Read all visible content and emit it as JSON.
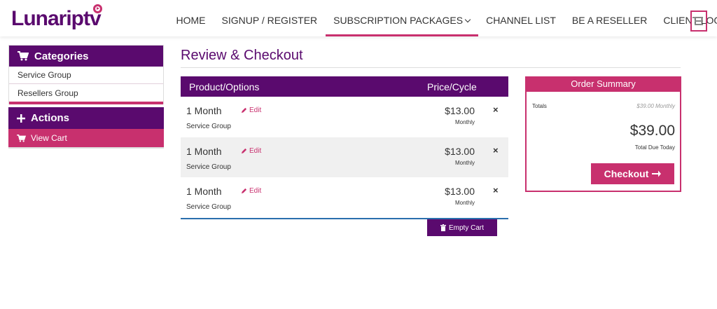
{
  "brand": {
    "logo_text": "Lunariptv"
  },
  "nav": {
    "items": [
      {
        "label": "HOME"
      },
      {
        "label": "SIGNUP / REGISTER"
      },
      {
        "label": "SUBSCRIPTION PACKAGES"
      },
      {
        "label": "CHANNEL LIST"
      },
      {
        "label": "BE A RESELLER"
      },
      {
        "label": "CLIENT LOGIN"
      }
    ],
    "menu_icon": "hamburger-icon"
  },
  "sidebar": {
    "categories_title": "Categories",
    "categories": [
      {
        "label": "Service Group"
      },
      {
        "label": "Resellers Group"
      }
    ],
    "actions_title": "Actions",
    "actions": [
      {
        "label": "View Cart"
      }
    ]
  },
  "page": {
    "title": "Review & Checkout"
  },
  "cart": {
    "col_product": "Product/Options",
    "col_price": "Price/Cycle",
    "items": [
      {
        "name": "1 Month",
        "edit_label": "Edit",
        "group": "Service Group",
        "price": "$13.00",
        "cycle": "Monthly"
      },
      {
        "name": "1 Month",
        "edit_label": "Edit",
        "group": "Service Group",
        "price": "$13.00",
        "cycle": "Monthly"
      },
      {
        "name": "1 Month",
        "edit_label": "Edit",
        "group": "Service Group",
        "price": "$13.00",
        "cycle": "Monthly"
      }
    ],
    "remove_symbol": "×",
    "empty_label": "Empty Cart"
  },
  "summary": {
    "title": "Order Summary",
    "totals_label": "Totals",
    "totals_value": "$39.00 Monthly",
    "total_due": "$39.00",
    "total_due_label": "Total Due Today",
    "checkout_label": "Checkout"
  },
  "colors": {
    "primary": "#5a0a6e",
    "accent": "#c8306e",
    "rule": "#2a6fad"
  }
}
